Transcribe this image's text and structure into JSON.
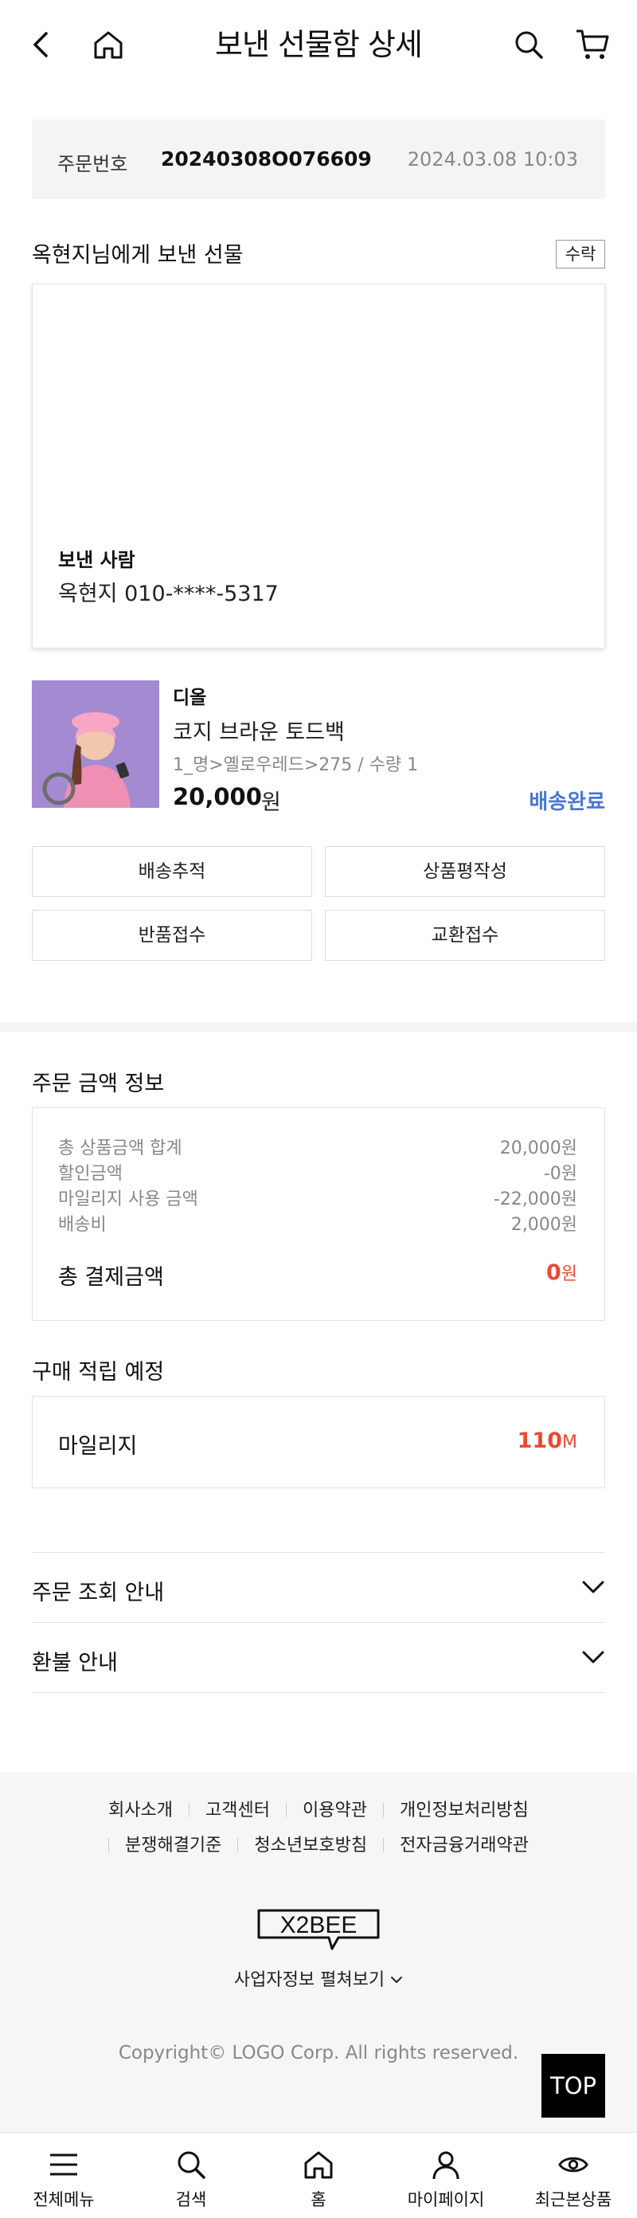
{
  "header": {
    "title": "보낸 선물함 상세",
    "back_icon": "chevron-left-icon",
    "home_icon": "home-icon",
    "search_icon": "search-icon",
    "cart_icon": "cart-icon"
  },
  "order": {
    "label": "주문번호",
    "number": "20240308O076609",
    "datetime": "2024.03.08 10:03"
  },
  "gift": {
    "title": "옥현지님에게 보낸 선물",
    "status_badge": "수락",
    "sender_label": "보낸 사람",
    "sender_value": "옥현지 010-****-5317"
  },
  "product": {
    "brand": "디올",
    "name": "코지 브라운 토드백",
    "option": "1_명>옐로우레드>275 / 수량 1",
    "price": "20,000",
    "currency": "원",
    "status": "배송완료",
    "status_color": "#4a77d4"
  },
  "actions": {
    "track": "배송추적",
    "review": "상품평작성",
    "return": "반품접수",
    "exchange": "교환접수"
  },
  "amount": {
    "title": "주문 금액 정보",
    "rows": [
      {
        "label": "총 상품금액 합계",
        "value": "20,000원"
      },
      {
        "label": "할인금액",
        "value": "-0원"
      },
      {
        "label": "마일리지 사용 금액",
        "value": "-22,000원"
      },
      {
        "label": "배송비",
        "value": "2,000원"
      }
    ],
    "total_label": "총 결제금액",
    "total_value": "0",
    "total_unit": "원",
    "accent_color": "#e84a33"
  },
  "mileage": {
    "title": "구매 적립 예정",
    "label": "마일리지",
    "value": "110",
    "unit": "M"
  },
  "accordions": [
    {
      "label": "주문 조회 안내"
    },
    {
      "label": "환불 안내"
    }
  ],
  "footer": {
    "links_row1": [
      "회사소개",
      "고객센터",
      "이용약관",
      "개인정보처리방침"
    ],
    "links_row2": [
      "분쟁해결기준",
      "청소년보호방침",
      "전자금융거래약관"
    ],
    "logo_text": "X2BEE",
    "biz_info": "사업자정보 펼쳐보기",
    "copyright": "Copyright© LOGO Corp. All rights reserved.",
    "top_button": "TOP"
  },
  "bottom_nav": [
    {
      "label": "전체메뉴",
      "icon": "menu-icon"
    },
    {
      "label": "검색",
      "icon": "search-icon"
    },
    {
      "label": "홈",
      "icon": "home-icon"
    },
    {
      "label": "마이페이지",
      "icon": "user-icon"
    },
    {
      "label": "최근본상품",
      "icon": "eye-icon"
    }
  ]
}
